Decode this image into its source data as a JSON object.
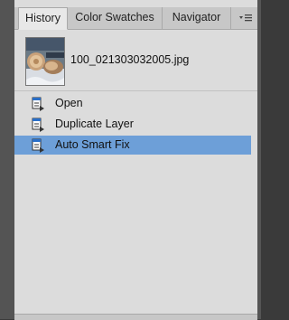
{
  "tabs": [
    {
      "label": "History"
    },
    {
      "label": "Color Swatches"
    },
    {
      "label": "Navigator"
    }
  ],
  "panel_menu_icon": "panel-menu-icon",
  "snapshot": {
    "filename": "100_021303032005.jpg"
  },
  "history": {
    "steps": [
      {
        "label": "Open",
        "icon": "history-step-icon"
      },
      {
        "label": "Duplicate Layer",
        "icon": "history-step-icon"
      },
      {
        "label": "Auto Smart Fix",
        "icon": "history-step-icon",
        "selected": true
      }
    ]
  },
  "colors": {
    "selection": "#6d9fd8",
    "panel": "#dcdcdc"
  }
}
